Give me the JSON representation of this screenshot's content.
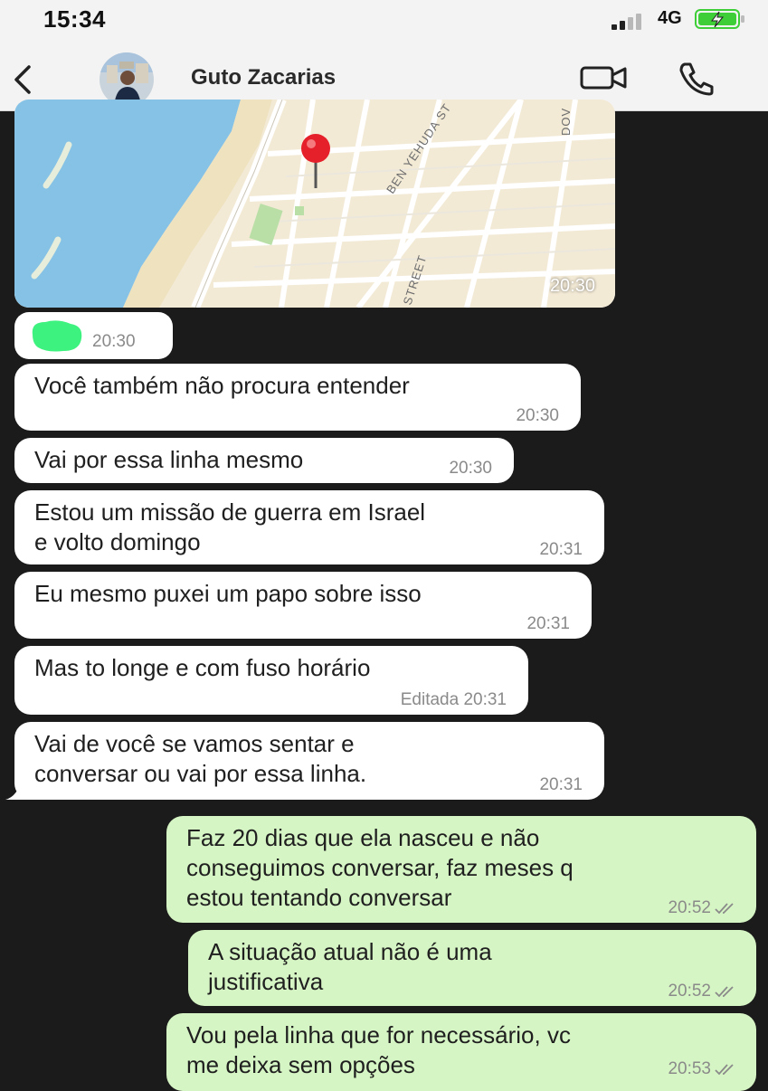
{
  "status_bar": {
    "time": "15:34",
    "network": "4G",
    "battery_charging": true
  },
  "header": {
    "contact_name": "Guto Zacarias",
    "back_icon": "chevron-left-icon",
    "video_icon": "video-camera-icon",
    "phone_icon": "phone-icon"
  },
  "map_message": {
    "labels": [
      "BEN YEHUDA ST",
      "STREET",
      "DOV"
    ],
    "time": "20:30"
  },
  "sticker_message": {
    "time": "20:30"
  },
  "messages": [
    {
      "direction": "in",
      "text": "Você também não procura entender",
      "time": "20:30"
    },
    {
      "direction": "in",
      "text": "Vai por essa linha mesmo",
      "time": "20:30"
    },
    {
      "direction": "in",
      "line1": "Estou um missão de guerra em Israel",
      "line2": "e volto domingo",
      "time": "20:31"
    },
    {
      "direction": "in",
      "text": "Eu mesmo puxei um papo sobre isso",
      "time": "20:31"
    },
    {
      "direction": "in",
      "text": "Mas to longe e com fuso horário",
      "time": "Editada 20:31"
    },
    {
      "direction": "in",
      "line1": "Vai de você se vamos sentar e",
      "line2": "conversar ou vai por essa linha.",
      "time": "20:31"
    },
    {
      "direction": "out",
      "line1": "Faz 20 dias que ela nasceu e não",
      "line2": "conseguimos conversar, faz meses q",
      "line3": "estou tentando conversar",
      "time": "20:52"
    },
    {
      "direction": "out",
      "line1": "A situação atual não é uma",
      "line2": "justificativa",
      "time": "20:52"
    },
    {
      "direction": "out",
      "line1": "Vou pela linha que for necessário,  vc",
      "line2": "me deixa sem opções",
      "time": "20:53"
    }
  ],
  "colors": {
    "chat_background": "#1b1b1b",
    "incoming_bubble": "#ffffff",
    "outgoing_bubble": "#d6f5c4",
    "map_pin": "#e5202a",
    "battery_fill": "#3ecf38"
  }
}
